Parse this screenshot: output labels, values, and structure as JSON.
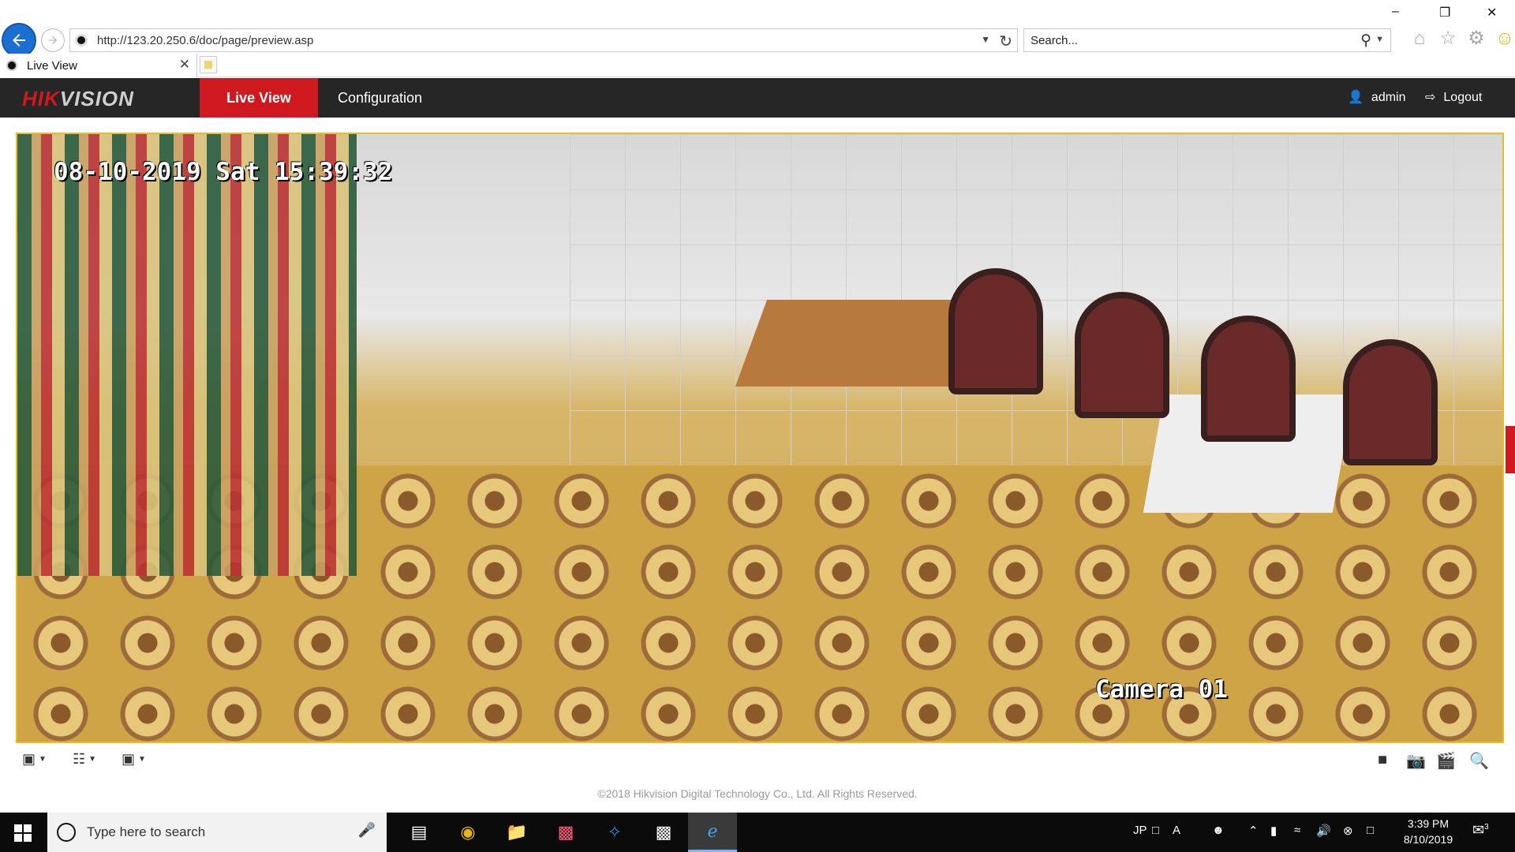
{
  "browser": {
    "url": "http://123.20.250.6/doc/page/preview.asp",
    "search_placeholder": "Search...",
    "tab_title": "Live View"
  },
  "app": {
    "logo_red": "HIK",
    "logo_grey": "VISION",
    "nav": {
      "live_view": "Live View",
      "configuration": "Configuration"
    },
    "user": "admin",
    "logout": "Logout"
  },
  "video": {
    "osd_timestamp": "08-10-2019 Sat 15:39:32",
    "osd_camera": "Camera 01"
  },
  "footer": "©2018 Hikvision Digital Technology Co., Ltd. All Rights Reserved.",
  "taskbar": {
    "search_placeholder": "Type here to search",
    "lang": "JP",
    "time": "3:39 PM",
    "date": "8/10/2019",
    "notif_count": "3"
  },
  "colors": {
    "brand_red": "#d0181f",
    "header_bg": "#262626",
    "video_border": "#e3bf2c"
  }
}
